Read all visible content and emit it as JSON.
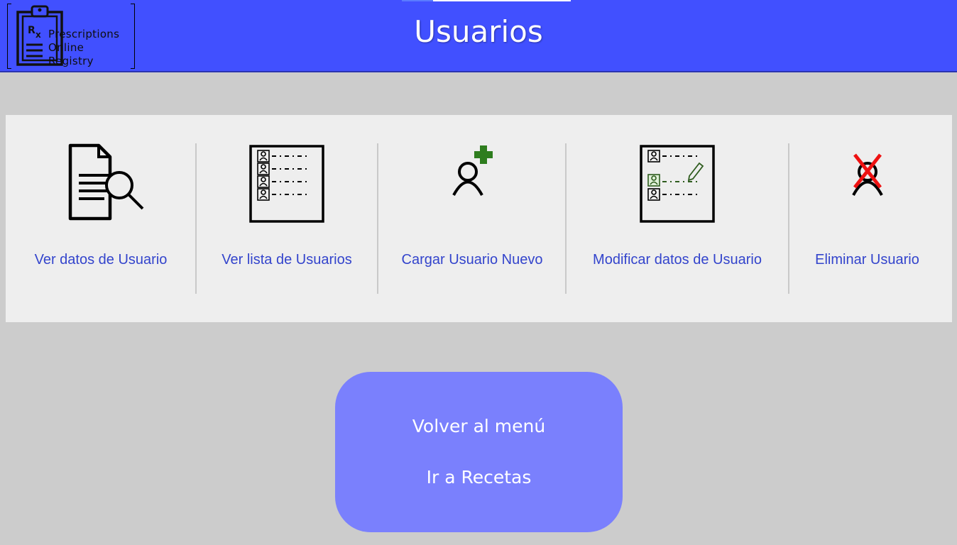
{
  "header": {
    "title": "Usuarios",
    "logo_text": [
      "Prescriptions",
      "Online",
      "Registry"
    ],
    "logo_rx": "Rx"
  },
  "colors": {
    "header_bg": "#4150ff",
    "page_bg": "#cccccc",
    "panel_bg": "#eeeeee",
    "link": "#3344cc",
    "nav_bg": "#7a80fd",
    "add_green": "#2e7d1e",
    "delete_red": "#ee1111"
  },
  "options": [
    {
      "label": "Ver datos de Usuario",
      "icon": "document-search-icon"
    },
    {
      "label": "Ver lista de Usuarios",
      "icon": "user-list-icon"
    },
    {
      "label": "Cargar Usuario Nuevo",
      "icon": "add-user-icon"
    },
    {
      "label": "Modificar datos de Usuario",
      "icon": "edit-user-list-icon"
    },
    {
      "label": "Eliminar Usuario",
      "icon": "delete-user-icon"
    }
  ],
  "nav": {
    "back_label": "Volver al menú",
    "recipes_label": "Ir a Recetas"
  }
}
